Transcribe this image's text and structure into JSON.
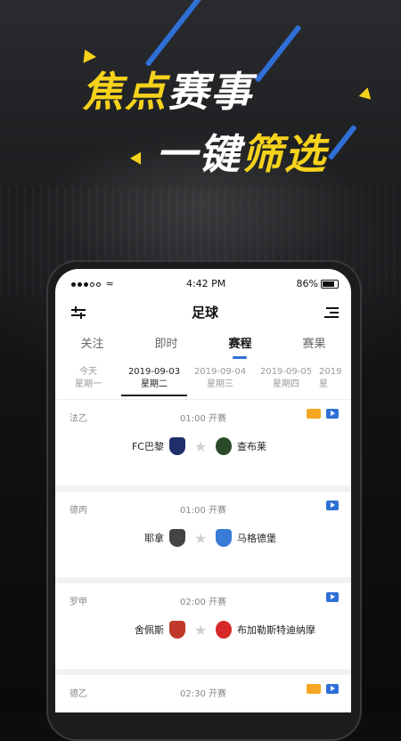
{
  "promo": {
    "line1_a": "焦点",
    "line1_b": "赛事",
    "line2_a": "一键",
    "line2_b": "筛选"
  },
  "status": {
    "time": "4:42 PM",
    "battery": "86%"
  },
  "header": {
    "title": "足球"
  },
  "tabs": [
    {
      "label": "关注"
    },
    {
      "label": "即时"
    },
    {
      "label": "赛程",
      "active": true
    },
    {
      "label": "赛果"
    }
  ],
  "dates": [
    {
      "line1": "今天",
      "line2": "星期一"
    },
    {
      "line1": "2019-09-03",
      "line2": "星期二",
      "active": true
    },
    {
      "line1": "2019-09-04",
      "line2": "星期三"
    },
    {
      "line1": "2019-09-05",
      "line2": "星期四"
    },
    {
      "line1": "2019",
      "line2": "星"
    }
  ],
  "matches": [
    {
      "league": "法乙",
      "time": "01:00 开赛",
      "home": "FC巴黎",
      "away": "查布莱",
      "home_color": "#1f2f6b",
      "away_color": "#2a4a2a",
      "animation": true,
      "video": true
    },
    {
      "league": "德丙",
      "time": "01:00 开赛",
      "home": "耶拿",
      "away": "马格德堡",
      "home_color": "#444444",
      "away_color": "#3a7bd5",
      "animation": false,
      "video": true
    },
    {
      "league": "罗甲",
      "time": "02:00 开赛",
      "home": "舍佩斯",
      "away": "布加勒斯特迪纳摩",
      "home_color": "#c0392b",
      "away_color": "#d62828",
      "animation": false,
      "video": true
    },
    {
      "league": "德乙",
      "time": "02:30 开赛",
      "animation": true,
      "video": true
    }
  ],
  "colors": {
    "accent": "#2f6fd6",
    "promo_yellow": "#f5d21b"
  }
}
